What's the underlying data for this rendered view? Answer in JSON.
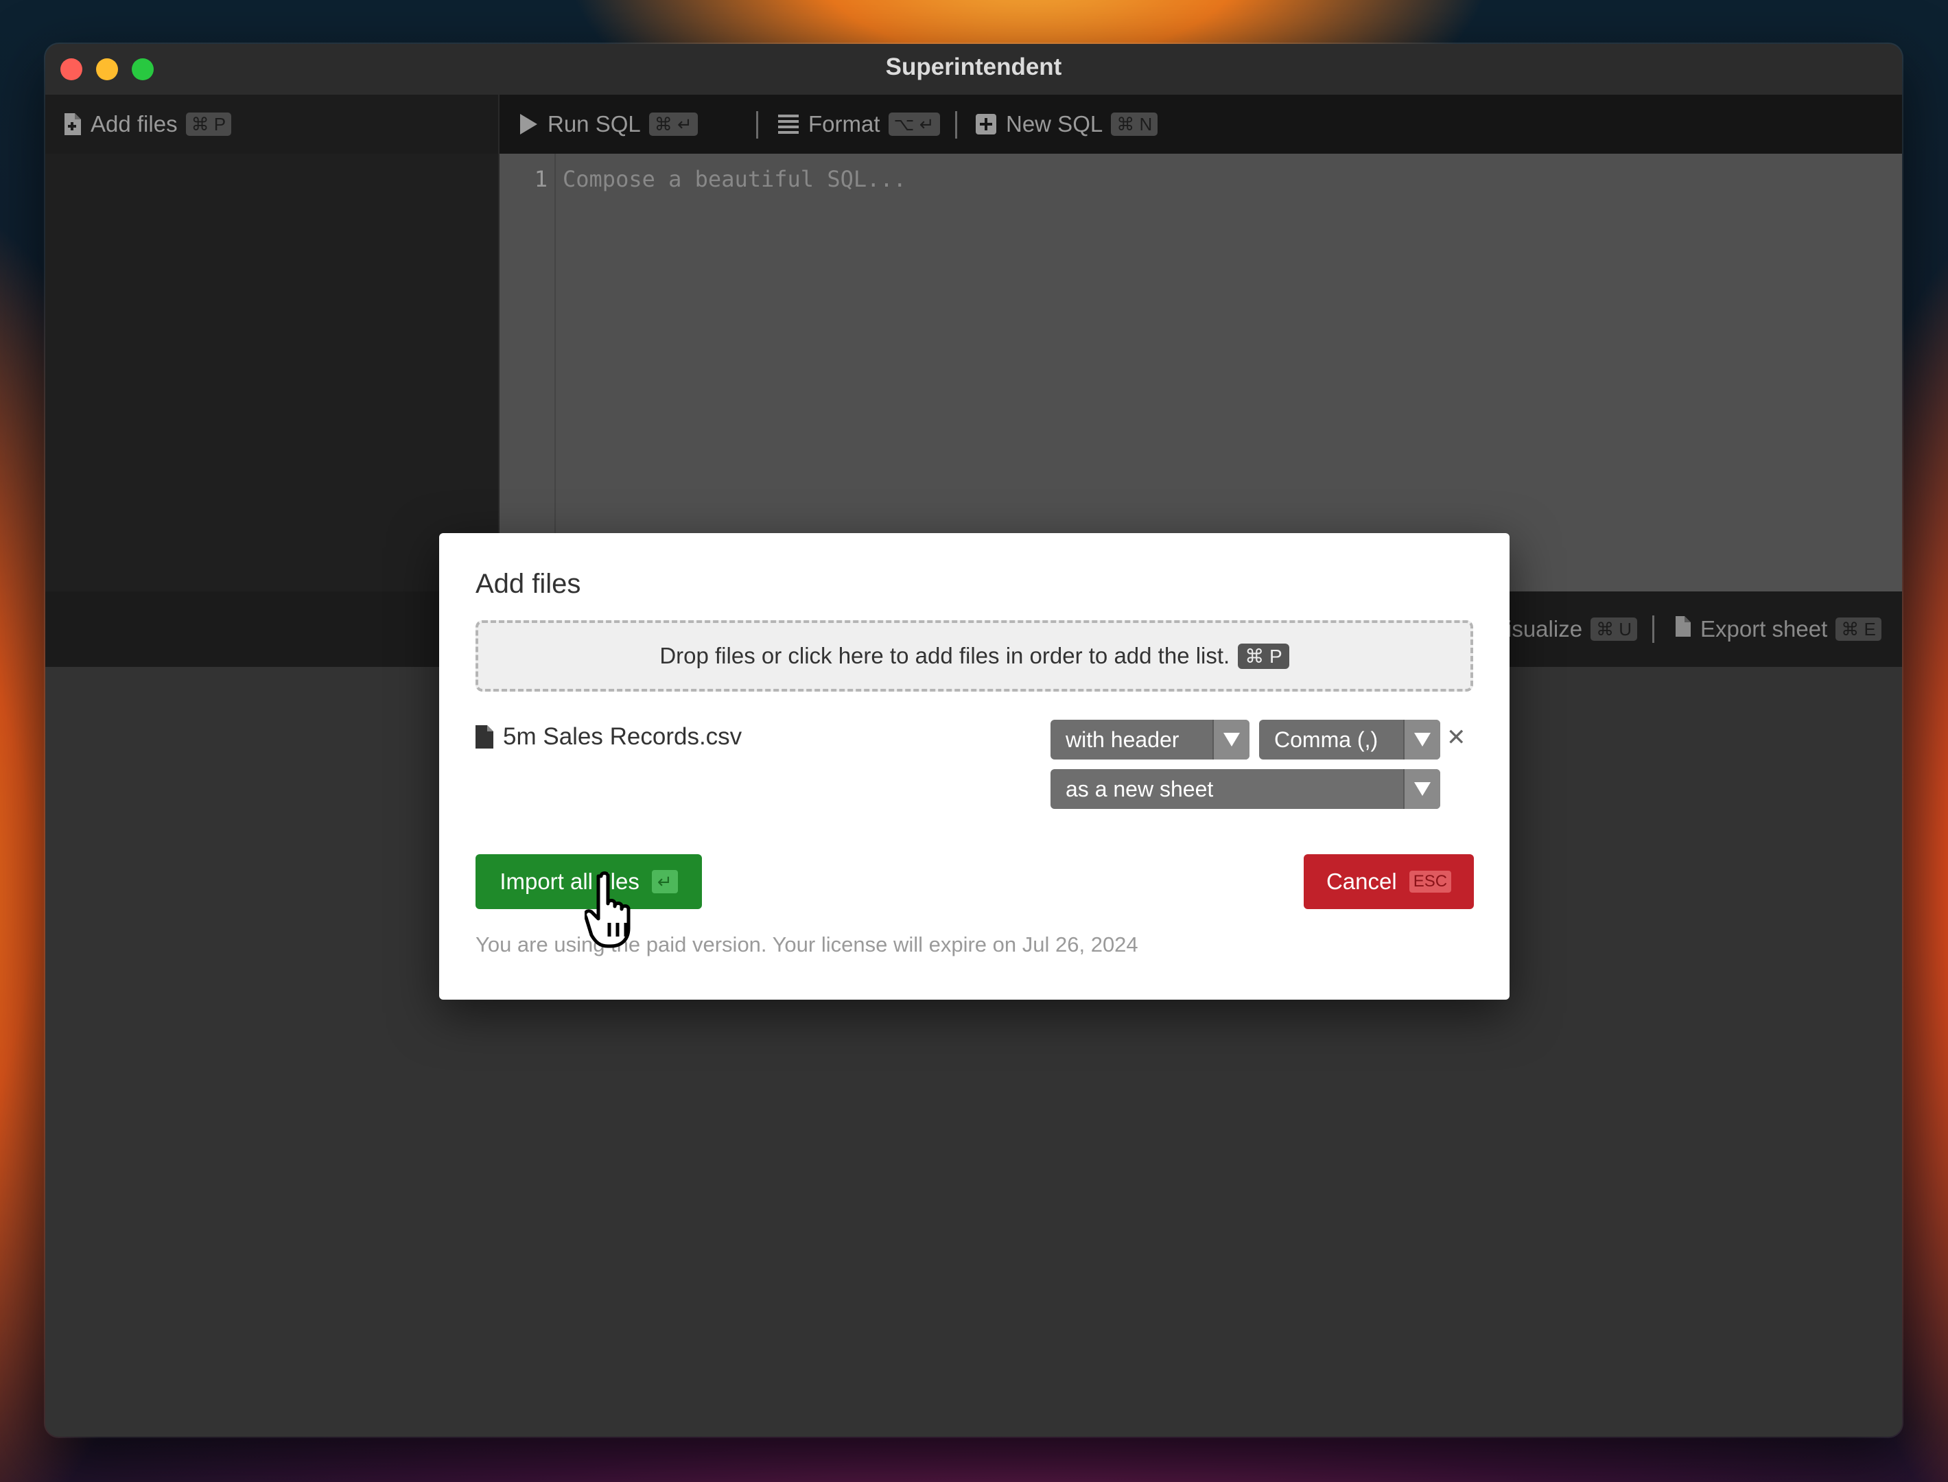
{
  "window": {
    "title": "Superintendent"
  },
  "sidebar": {
    "add_files_label": "Add files",
    "add_files_shortcut": "⌘ P",
    "icon": "file-plus-icon"
  },
  "toolbar": {
    "run_sql_label": "Run SQL",
    "run_sql_shortcut": "⌘ ↵",
    "format_label": "Format",
    "format_shortcut": "⌥ ↵",
    "new_sql_label": "New SQL",
    "new_sql_shortcut": "⌘ N"
  },
  "editor": {
    "line_number": "1",
    "placeholder": "Compose a beautiful SQL..."
  },
  "results_toolbar": {
    "visualize_label": "isualize",
    "visualize_shortcut": "⌘ U",
    "export_label": "Export sheet",
    "export_shortcut": "⌘ E"
  },
  "modal": {
    "title": "Add files",
    "dropzone_text": "Drop files or click here to add files in order to add the list.",
    "dropzone_shortcut": "⌘ P",
    "file": {
      "name": "5m Sales Records.csv",
      "header_option": "with header",
      "delimiter_option": "Comma (,)",
      "target_option": "as a new sheet"
    },
    "import_label": "Import all files",
    "import_shortcut": "↵",
    "cancel_label": "Cancel",
    "cancel_shortcut": "ESC",
    "license_text": "You are using the paid version. Your license will expire on Jul 26, 2024"
  },
  "colors": {
    "import_green": "#1f8a2a",
    "cancel_red": "#c1212a"
  }
}
